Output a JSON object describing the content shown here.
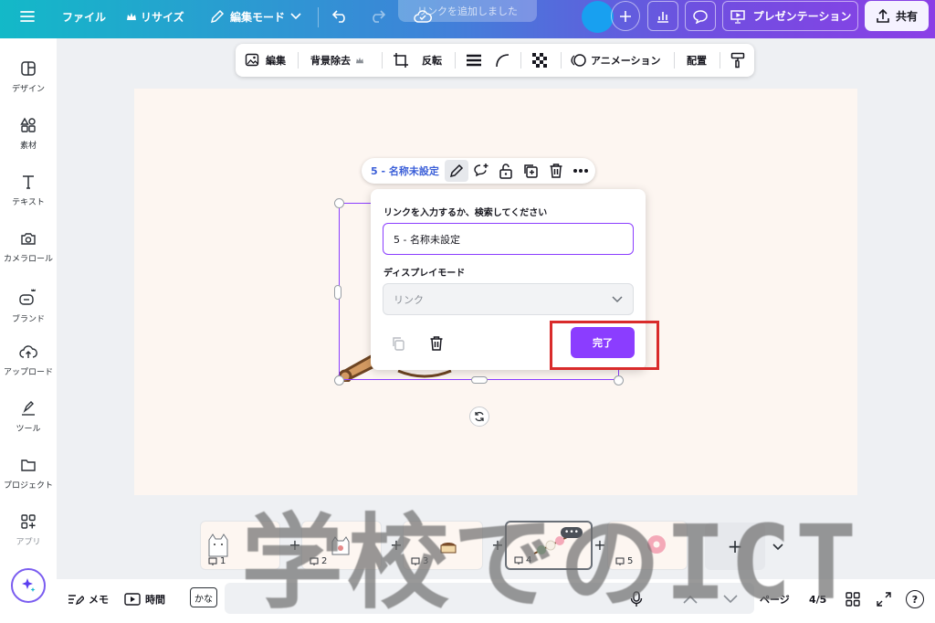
{
  "topbar": {
    "file_label": "ファイル",
    "resize_label": "リサイズ",
    "edit_mode_label": "編集モード",
    "toast_text": "リンクを追加しました",
    "present_label": "プレゼンテーション",
    "share_label": "共有"
  },
  "sidebar": {
    "items": [
      {
        "label": "デザイン"
      },
      {
        "label": "素材"
      },
      {
        "label": "テキスト"
      },
      {
        "label": "カメラロール"
      },
      {
        "label": "ブランド"
      },
      {
        "label": "アップロード"
      },
      {
        "label": "ツール"
      },
      {
        "label": "プロジェクト"
      },
      {
        "label": "アプリ"
      }
    ]
  },
  "edit_toolbar": {
    "edit_label": "編集",
    "bg_remove_label": "背景除去",
    "flip_label": "反転",
    "animation_label": "アニメーション",
    "position_label": "配置"
  },
  "context_bar": {
    "element_name": "5 - 名称未設定"
  },
  "link_popup": {
    "link_prompt": "リンクを入力するか、検索してください",
    "link_value": "5 - 名称未設定",
    "display_mode_label": "ディスプレイモード",
    "display_mode_value": "リンク",
    "done_label": "完了"
  },
  "pages": {
    "thumbs": [
      {
        "num": "1"
      },
      {
        "num": "2"
      },
      {
        "num": "3"
      },
      {
        "num": "4"
      },
      {
        "num": "5"
      }
    ],
    "more_label": "•••"
  },
  "bottombar": {
    "memo_label": "メモ",
    "time_label": "時間",
    "kana_label": "かな",
    "page_label": "ページ",
    "page_counter": "4/5",
    "help_label": "?"
  },
  "watermark": {
    "text": "学校でのICT"
  },
  "colors": {
    "accent": "#8b3dff",
    "highlight": "#d92b2b",
    "avatar": "#18a0f0"
  }
}
